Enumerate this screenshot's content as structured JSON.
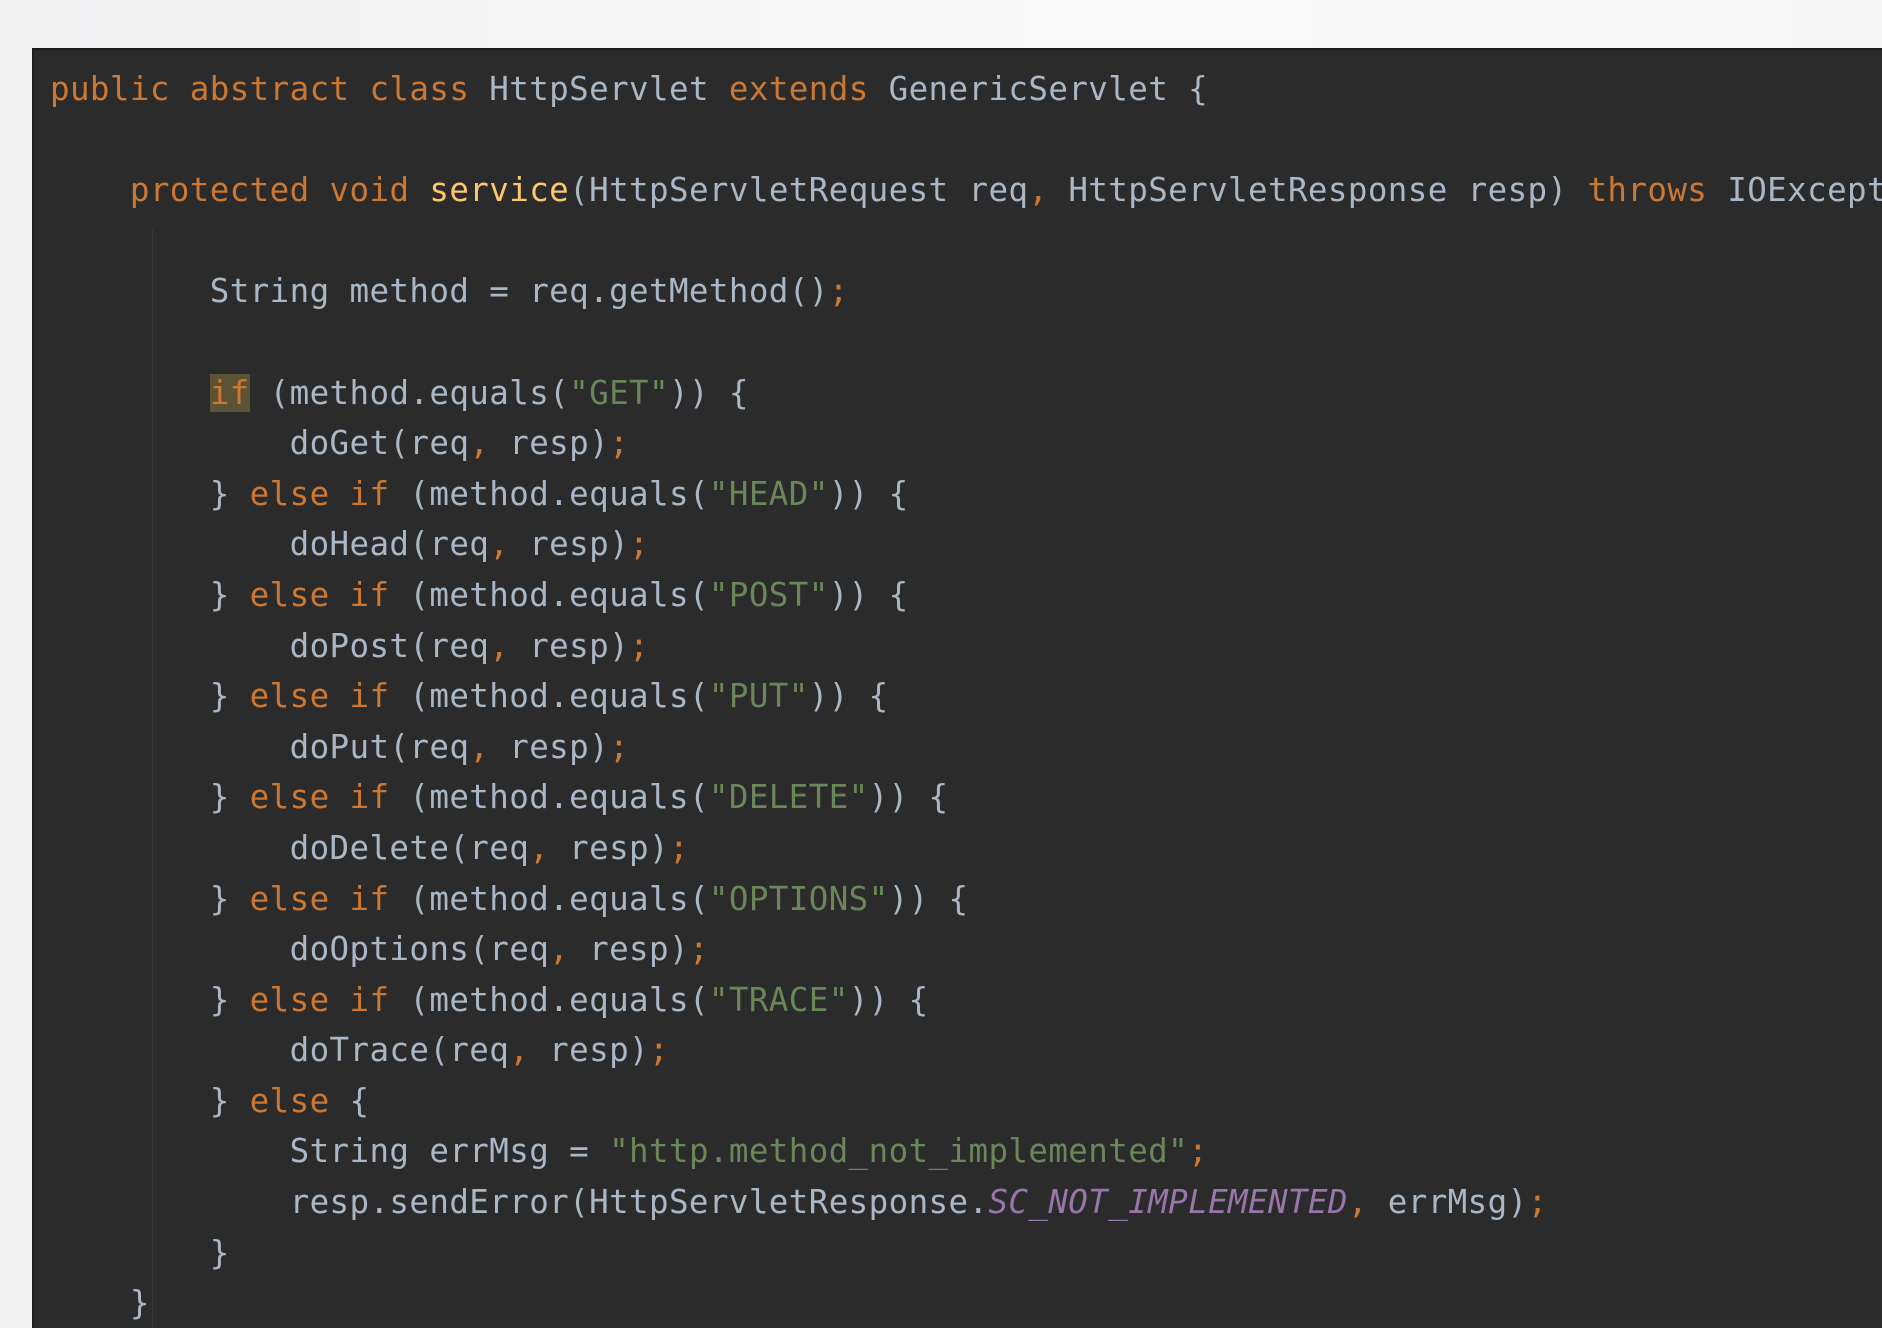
{
  "colors": {
    "editor_background": "#2b2b2b",
    "keyword": "#cc7832",
    "method_declaration": "#ffc66d",
    "plain_text": "#a9b7c6",
    "string_literal": "#6a8759",
    "static_constant": "#9876aa",
    "caret_highlight": "#5c5234"
  },
  "code_lines": [
    [
      {
        "t": "public abstract class ",
        "c": "kw"
      },
      {
        "t": "HttpServlet "
      },
      {
        "t": "extends ",
        "c": "kw"
      },
      {
        "t": "GenericServlet {"
      }
    ],
    [],
    [
      {
        "t": "    "
      },
      {
        "t": "protected void ",
        "c": "kw"
      },
      {
        "t": "service",
        "c": "fn"
      },
      {
        "t": "(HttpServletRequest req"
      },
      {
        "t": ", ",
        "c": "punc"
      },
      {
        "t": "HttpServletResponse resp) "
      },
      {
        "t": "throws ",
        "c": "kw"
      },
      {
        "t": "IOException {"
      }
    ],
    [],
    [
      {
        "t": "        String method = req.getMethod()"
      },
      {
        "t": ";",
        "c": "punc"
      }
    ],
    [],
    [
      {
        "t": "        "
      },
      {
        "t": "if",
        "c": "hl"
      },
      {
        "t": " (method.equals("
      },
      {
        "t": "\"GET\"",
        "c": "str"
      },
      {
        "t": ")) {"
      }
    ],
    [
      {
        "t": "            doGet(req"
      },
      {
        "t": ", ",
        "c": "punc"
      },
      {
        "t": "resp)"
      },
      {
        "t": ";",
        "c": "punc"
      }
    ],
    [
      {
        "t": "        } "
      },
      {
        "t": "else if ",
        "c": "kw"
      },
      {
        "t": "(method.equals("
      },
      {
        "t": "\"HEAD\"",
        "c": "str"
      },
      {
        "t": ")) {"
      }
    ],
    [
      {
        "t": "            doHead(req"
      },
      {
        "t": ", ",
        "c": "punc"
      },
      {
        "t": "resp)"
      },
      {
        "t": ";",
        "c": "punc"
      }
    ],
    [
      {
        "t": "        } "
      },
      {
        "t": "else if ",
        "c": "kw"
      },
      {
        "t": "(method.equals("
      },
      {
        "t": "\"POST\"",
        "c": "str"
      },
      {
        "t": ")) {"
      }
    ],
    [
      {
        "t": "            doPost(req"
      },
      {
        "t": ", ",
        "c": "punc"
      },
      {
        "t": "resp)"
      },
      {
        "t": ";",
        "c": "punc"
      }
    ],
    [
      {
        "t": "        } "
      },
      {
        "t": "else if ",
        "c": "kw"
      },
      {
        "t": "(method.equals("
      },
      {
        "t": "\"PUT\"",
        "c": "str"
      },
      {
        "t": ")) {"
      }
    ],
    [
      {
        "t": "            doPut(req"
      },
      {
        "t": ", ",
        "c": "punc"
      },
      {
        "t": "resp)"
      },
      {
        "t": ";",
        "c": "punc"
      }
    ],
    [
      {
        "t": "        } "
      },
      {
        "t": "else if ",
        "c": "kw"
      },
      {
        "t": "(method.equals("
      },
      {
        "t": "\"DELETE\"",
        "c": "str"
      },
      {
        "t": ")) {"
      }
    ],
    [
      {
        "t": "            doDelete(req"
      },
      {
        "t": ", ",
        "c": "punc"
      },
      {
        "t": "resp)"
      },
      {
        "t": ";",
        "c": "punc"
      }
    ],
    [
      {
        "t": "        } "
      },
      {
        "t": "else if ",
        "c": "kw"
      },
      {
        "t": "(method.equals("
      },
      {
        "t": "\"OPTIONS\"",
        "c": "str"
      },
      {
        "t": ")) {"
      }
    ],
    [
      {
        "t": "            doOptions(req"
      },
      {
        "t": ", ",
        "c": "punc"
      },
      {
        "t": "resp)"
      },
      {
        "t": ";",
        "c": "punc"
      }
    ],
    [
      {
        "t": "        } "
      },
      {
        "t": "else if ",
        "c": "kw"
      },
      {
        "t": "(method.equals("
      },
      {
        "t": "\"TRACE\"",
        "c": "str"
      },
      {
        "t": ")) {"
      }
    ],
    [
      {
        "t": "            doTrace(req"
      },
      {
        "t": ", ",
        "c": "punc"
      },
      {
        "t": "resp)"
      },
      {
        "t": ";",
        "c": "punc"
      }
    ],
    [
      {
        "t": "        } "
      },
      {
        "t": "else ",
        "c": "kw"
      },
      {
        "t": "{"
      }
    ],
    [
      {
        "t": "            String errMsg = "
      },
      {
        "t": "\"http.method_not_implemented\"",
        "c": "str"
      },
      {
        "t": ";",
        "c": "punc"
      }
    ],
    [
      {
        "t": "            resp.sendError(HttpServletResponse."
      },
      {
        "t": "SC_NOT_IMPLEMENTED",
        "c": "const"
      },
      {
        "t": ", ",
        "c": "punc"
      },
      {
        "t": "errMsg)"
      },
      {
        "t": ";",
        "c": "punc"
      }
    ],
    [
      {
        "t": "        }"
      }
    ],
    [
      {
        "t": "    }"
      }
    ]
  ]
}
